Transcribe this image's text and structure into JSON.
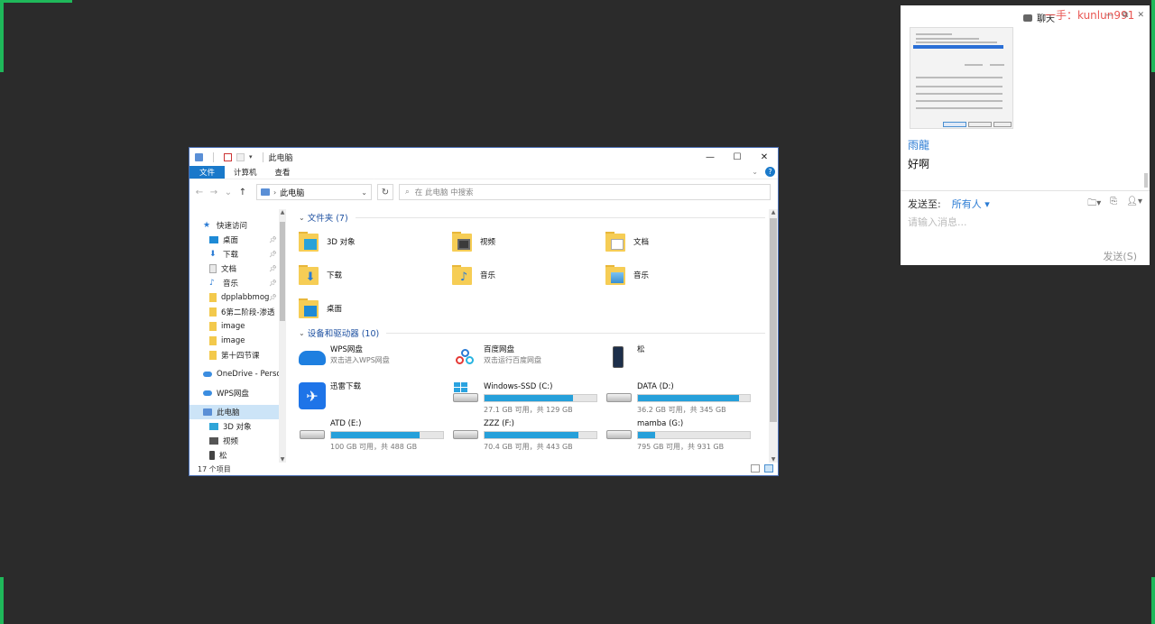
{
  "explorer": {
    "title": "此电脑",
    "ribbon_tabs": [
      "文件",
      "计算机",
      "查看"
    ],
    "address": "此电脑",
    "search_placeholder": "在 此电脑 中搜索",
    "nav": [
      {
        "label": "快速访问",
        "icon": "star-icon",
        "pinned": false,
        "level": 1
      },
      {
        "label": "桌面",
        "icon": "desktop-icon",
        "pinned": true,
        "level": 2
      },
      {
        "label": "下载",
        "icon": "download-icon",
        "pinned": true,
        "level": 2
      },
      {
        "label": "文档",
        "icon": "document-icon",
        "pinned": true,
        "level": 2
      },
      {
        "label": "音乐",
        "icon": "music-icon",
        "pinned": true,
        "level": 2
      },
      {
        "label": "dpplabbmog",
        "icon": "folder-icon",
        "pinned": true,
        "level": 2
      },
      {
        "label": "6第二阶段-渗透",
        "icon": "folder-icon",
        "pinned": false,
        "level": 2
      },
      {
        "label": "image",
        "icon": "folder-icon",
        "pinned": false,
        "level": 2
      },
      {
        "label": "image",
        "icon": "folder-icon",
        "pinned": false,
        "level": 2
      },
      {
        "label": "第十四节课",
        "icon": "folder-icon",
        "pinned": false,
        "level": 2
      },
      {
        "label": "OneDrive - Perso",
        "icon": "onedrive-icon",
        "pinned": false,
        "level": 1
      },
      {
        "label": "WPS网盘",
        "icon": "wps-cloud-icon",
        "pinned": false,
        "level": 1
      },
      {
        "label": "此电脑",
        "icon": "this-pc-icon",
        "pinned": false,
        "level": 1,
        "selected": true
      },
      {
        "label": "3D 对象",
        "icon": "3d-objects-icon",
        "pinned": false,
        "level": 2
      },
      {
        "label": "视频",
        "icon": "video-icon",
        "pinned": false,
        "level": 2
      },
      {
        "label": "松",
        "icon": "phone-icon",
        "pinned": false,
        "level": 2
      }
    ],
    "folders_header": "文件夹 (7)",
    "folders": [
      {
        "name": "3D 对象",
        "icon": "3d-objects-folder-icon"
      },
      {
        "name": "视频",
        "icon": "videos-folder-icon"
      },
      {
        "name": "文档",
        "icon": "documents-folder-icon"
      },
      {
        "name": "下载",
        "icon": "downloads-folder-icon"
      },
      {
        "name": "音乐",
        "icon": "music-folder-icon"
      },
      {
        "name": "音乐",
        "icon": "pictures-folder-icon"
      },
      {
        "name": "桌面",
        "icon": "desktop-folder-icon"
      }
    ],
    "drives_header": "设备和驱动器 (10)",
    "drives": [
      {
        "name": "WPS网盘",
        "sub": "双击进入WPS网盘",
        "icon": "wps-cloud-icon"
      },
      {
        "name": "百度网盘",
        "sub": "双击运行百度网盘",
        "icon": "baidu-netdisk-icon"
      },
      {
        "name": "松",
        "sub": "",
        "icon": "phone-device-icon"
      },
      {
        "name": "迅雷下载",
        "sub": "",
        "icon": "xunlei-icon"
      },
      {
        "name": "Windows-SSD (C:)",
        "sub": "27.1 GB 可用，共 129 GB",
        "icon": "system-drive-icon",
        "used": 0.79
      },
      {
        "name": "DATA (D:)",
        "sub": "36.2 GB 可用，共 345 GB",
        "icon": "hard-drive-icon",
        "used": 0.9
      },
      {
        "name": "ATD (E:)",
        "sub": "100 GB 可用，共 488 GB",
        "icon": "hard-drive-icon",
        "used": 0.79
      },
      {
        "name": "ZZZ (F:)",
        "sub": "70.4 GB 可用，共 443 GB",
        "icon": "hard-drive-icon",
        "used": 0.84
      },
      {
        "name": "mamba (G:)",
        "sub": "795 GB 可用，共 931 GB",
        "icon": "hard-drive-icon",
        "used": 0.15
      }
    ],
    "status": "17 个项目"
  },
  "chat": {
    "title": "聊天",
    "watermark": "一手：kunlun991",
    "sender": "雨龍",
    "message": "好啊",
    "send_to_label": "发送至:",
    "send_to_value": "所有人",
    "input_placeholder": "请输入消息...",
    "send_button": "发送(S)"
  }
}
